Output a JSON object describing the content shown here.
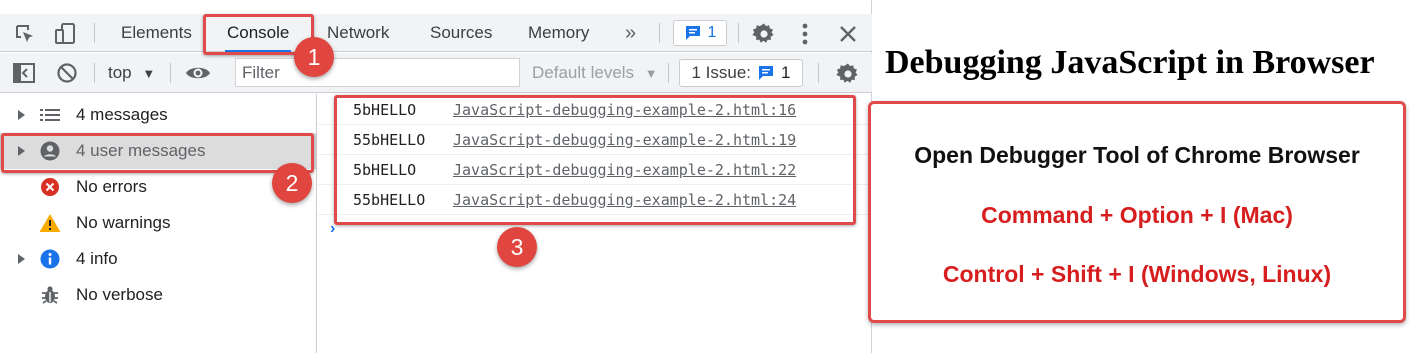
{
  "devtools": {
    "tabs": [
      {
        "label": "Elements",
        "active": false
      },
      {
        "label": "Console",
        "active": true
      },
      {
        "label": "Network",
        "active": false
      },
      {
        "label": "Sources",
        "active": false
      },
      {
        "label": "Memory",
        "active": false
      }
    ],
    "more_tabs_glyph": "»",
    "message_badge_count": "1",
    "toolbar": {
      "context": "top",
      "filter_placeholder": "Filter",
      "levels_label": "Default levels",
      "issues_label": "1 Issue:",
      "issues_count": "1"
    },
    "sidebar": {
      "items": [
        {
          "label": "4 messages",
          "icon": "list-icon",
          "expandable": true,
          "selected": false
        },
        {
          "label": "4 user messages",
          "icon": "user-icon",
          "expandable": true,
          "selected": true
        },
        {
          "label": "No errors",
          "icon": "error-icon",
          "expandable": false,
          "selected": false
        },
        {
          "label": "No warnings",
          "icon": "warning-icon",
          "expandable": false,
          "selected": false
        },
        {
          "label": "4 info",
          "icon": "info-icon",
          "expandable": true,
          "selected": false
        },
        {
          "label": "No verbose",
          "icon": "bug-icon",
          "expandable": false,
          "selected": false
        }
      ]
    },
    "console": {
      "messages": [
        {
          "text": "5bHELLO",
          "source": "JavaScript-debugging-example-2.html:16"
        },
        {
          "text": "55bHELLO",
          "source": "JavaScript-debugging-example-2.html:19"
        },
        {
          "text": "5bHELLO",
          "source": "JavaScript-debugging-example-2.html:22"
        },
        {
          "text": "55bHELLO",
          "source": "JavaScript-debugging-example-2.html:24"
        }
      ],
      "prompt_glyph": "›"
    }
  },
  "annotations": {
    "numbers": [
      "1",
      "2",
      "3"
    ],
    "color": "#e0453f"
  },
  "page": {
    "title": "Debugging JavaScript in Browser",
    "card": {
      "heading": "Open Debugger Tool of Chrome Browser",
      "line1": "Command + Option + I (Mac)",
      "line2": "Control + Shift + I (Windows, Linux)"
    }
  },
  "colors": {
    "accent": "#1a73e8",
    "annotation_red": "#e04a4a",
    "shortcut_red": "#d71e1e",
    "error_red": "#d93025",
    "warning_yellow": "#f9ab00",
    "info_blue": "#1a73e8"
  }
}
